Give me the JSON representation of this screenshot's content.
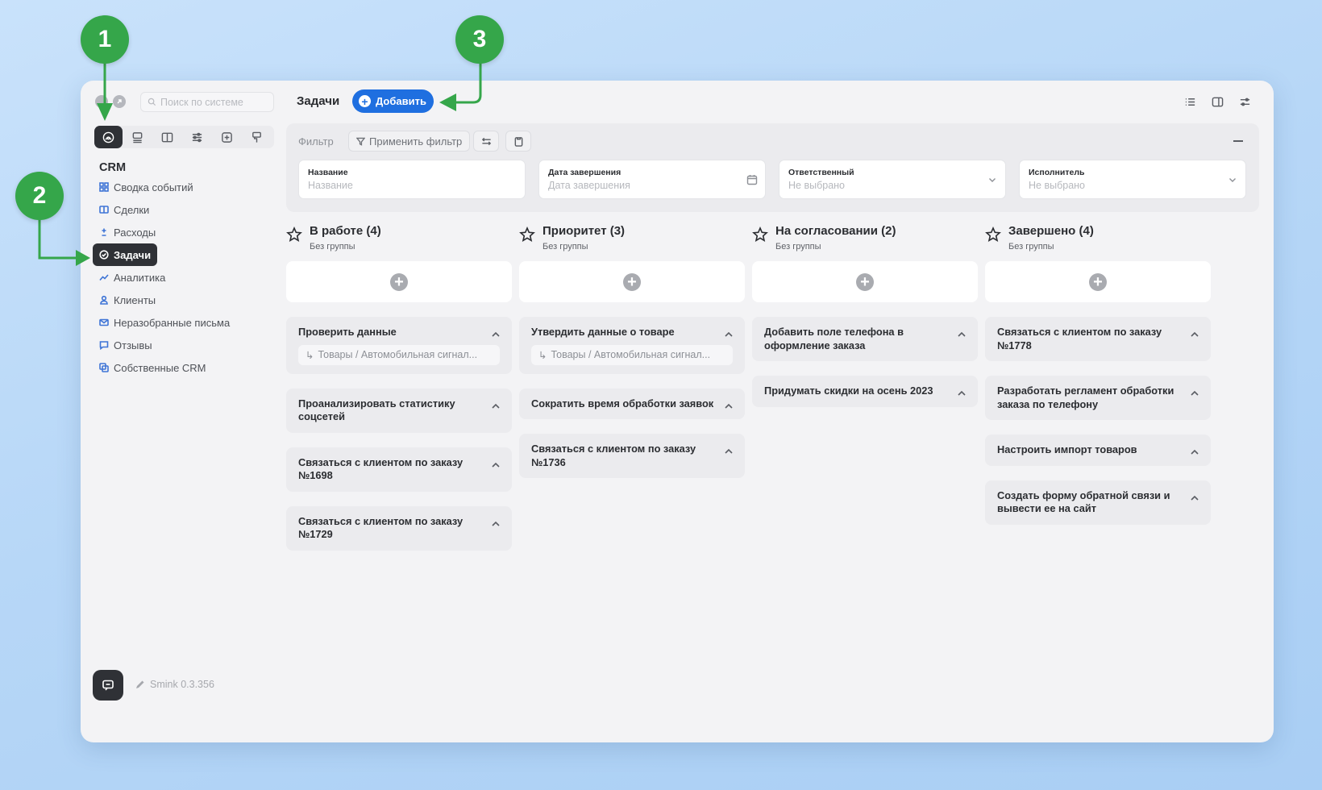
{
  "sidebar": {
    "search_placeholder": "Поиск по системе",
    "section_title": "CRM",
    "toolbar_icons": [
      "dashboard-icon",
      "layout-icon",
      "book-icon",
      "sliders-icon",
      "plus-square-icon",
      "paint-roller-icon"
    ],
    "items": [
      {
        "label": "Сводка событий",
        "icon": "grid-icon"
      },
      {
        "label": "Сделки",
        "icon": "deals-icon"
      },
      {
        "label": "Расходы",
        "icon": "plus-minus-icon"
      },
      {
        "label": "Задачи",
        "icon": "check-circle-icon",
        "active": true
      },
      {
        "label": "Аналитика",
        "icon": "chart-line-icon"
      },
      {
        "label": "Клиенты",
        "icon": "user-icon"
      },
      {
        "label": "Неразобранные письма",
        "icon": "mail-icon"
      },
      {
        "label": "Отзывы",
        "icon": "message-icon"
      },
      {
        "label": "Собственные CRM",
        "icon": "copy-icon"
      }
    ],
    "version": "Smink 0.3.356"
  },
  "header": {
    "title": "Задачи",
    "add_label": "Добавить"
  },
  "filter": {
    "label": "Фильтр",
    "apply_label": "Применить фильтр",
    "fields": [
      {
        "label": "Название",
        "value": "Название"
      },
      {
        "label": "Дата завершения",
        "value": "Дата завершения"
      },
      {
        "label": "Ответственный",
        "value": "Не выбрано"
      },
      {
        "label": "Исполнитель",
        "value": "Не выбрано"
      }
    ]
  },
  "columns": [
    {
      "title": "В работе (4)",
      "subtitle": "Без группы",
      "cards": [
        {
          "title": "Проверить данные",
          "sub": "Товары / Автомобильная сигнал..."
        },
        {
          "title": "Проанализировать статистику соцсетей"
        },
        {
          "title": "Связаться с клиентом по заказу №1698"
        },
        {
          "title": "Связаться с клиентом по заказу №1729"
        }
      ]
    },
    {
      "title": "Приоритет (3)",
      "subtitle": "Без группы",
      "cards": [
        {
          "title": "Утвердить данные о товаре",
          "sub": "Товары / Автомобильная сигнал..."
        },
        {
          "title": "Сократить время обработки заявок"
        },
        {
          "title": "Связаться с клиентом по заказу №1736"
        }
      ]
    },
    {
      "title": "На согласовании (2)",
      "subtitle": "Без группы",
      "cards": [
        {
          "title": "Добавить поле телефона в оформление заказа"
        },
        {
          "title": "Придумать скидки на осень 2023"
        }
      ]
    },
    {
      "title": "Завершено (4)",
      "subtitle": "Без группы",
      "cards": [
        {
          "title": "Связаться с клиентом по заказу №1778"
        },
        {
          "title": "Разработать регламент обработки заказа по телефону"
        },
        {
          "title": "Настроить импорт товаров"
        },
        {
          "title": "Создать форму обратной связи и вывести ее на сайт"
        }
      ]
    }
  ],
  "callouts": [
    "1",
    "2",
    "3"
  ],
  "colors": {
    "accent": "#1f6fe0",
    "callout": "#35a64a",
    "dark": "#2f3136"
  }
}
